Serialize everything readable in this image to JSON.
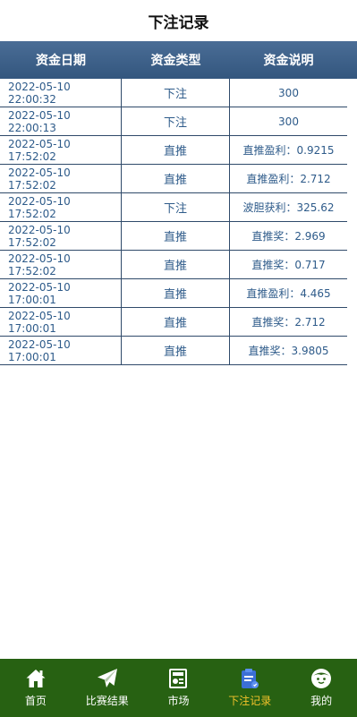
{
  "header": {
    "title": "下注记录"
  },
  "table": {
    "columns": [
      "资金日期",
      "资金类型",
      "资金说明"
    ],
    "rows": [
      {
        "date": "2022-05-10 22:00:32",
        "type": "下注",
        "desc": "300"
      },
      {
        "date": "2022-05-10 22:00:13",
        "type": "下注",
        "desc": "300"
      },
      {
        "date": "2022-05-10 17:52:02",
        "type": "直推",
        "desc": "直推盈利：0.9215"
      },
      {
        "date": "2022-05-10 17:52:02",
        "type": "直推",
        "desc": "直推盈利：2.712"
      },
      {
        "date": "2022-05-10 17:52:02",
        "type": "下注",
        "desc": "波胆获利：325.62"
      },
      {
        "date": "2022-05-10 17:52:02",
        "type": "直推",
        "desc": "直推奖：2.969"
      },
      {
        "date": "2022-05-10 17:52:02",
        "type": "直推",
        "desc": "直推奖：0.717"
      },
      {
        "date": "2022-05-10 17:00:01",
        "type": "直推",
        "desc": "直推盈利：4.465"
      },
      {
        "date": "2022-05-10 17:00:01",
        "type": "直推",
        "desc": "直推奖：2.712"
      },
      {
        "date": "2022-05-10 17:00:01",
        "type": "直推",
        "desc": "直推奖：3.9805"
      }
    ]
  },
  "tabbar": {
    "items": [
      {
        "label": "首页",
        "icon": "home-icon"
      },
      {
        "label": "比赛结果",
        "icon": "paper-plane-icon"
      },
      {
        "label": "市场",
        "icon": "market-icon"
      },
      {
        "label": "下注记录",
        "icon": "clipboard-icon",
        "active": true
      },
      {
        "label": "我的",
        "icon": "face-icon"
      }
    ]
  },
  "colors": {
    "header_bg": "#33567e",
    "tabbar_bg": "#276112",
    "active_tab": "#f3c22b",
    "cell_text": "#2e5b8a"
  }
}
